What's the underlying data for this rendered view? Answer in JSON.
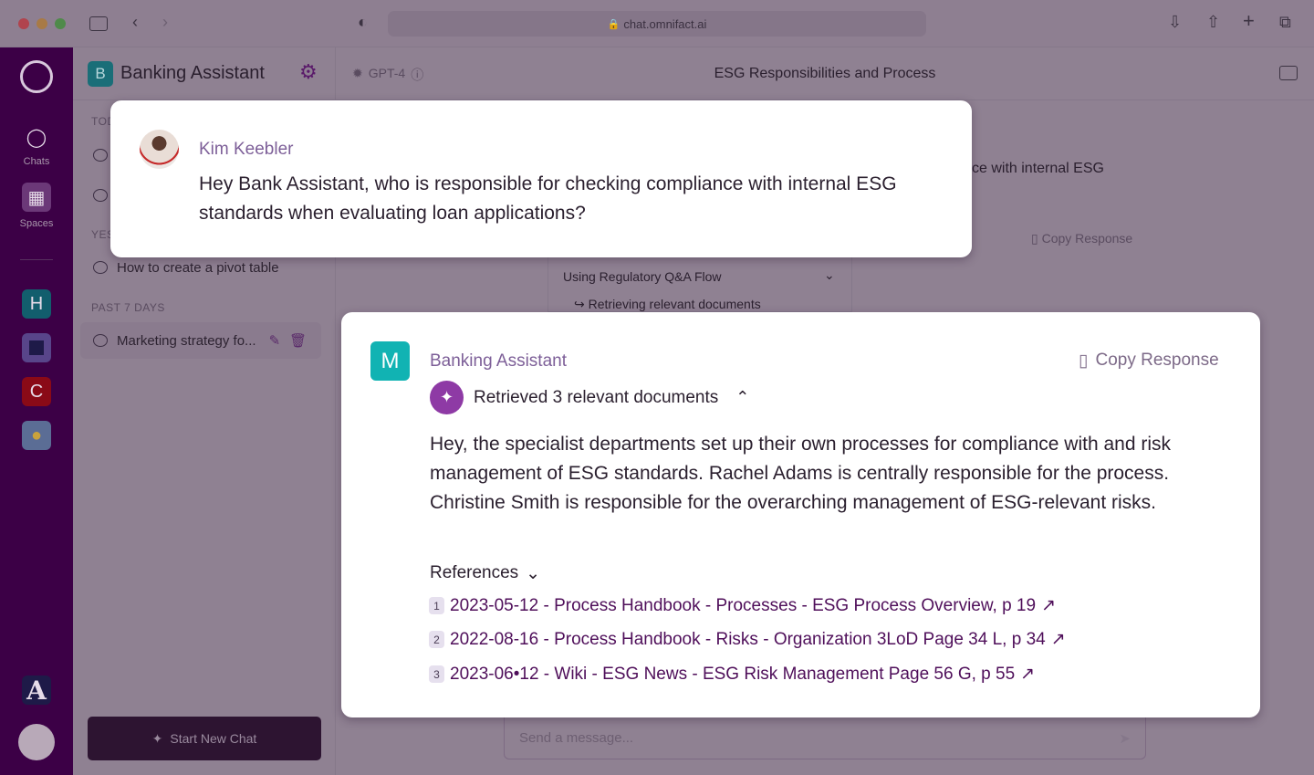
{
  "browser": {
    "url": "chat.omnifact.ai"
  },
  "rail": {
    "chats_label": "Chats",
    "spaces_label": "Spaces",
    "spaces": [
      {
        "letter": "H",
        "color": "#125e6d"
      },
      {
        "letter": "",
        "color": "#58458a"
      },
      {
        "letter": "C",
        "color": "#8a0a17"
      },
      {
        "letter": "",
        "color": "#5b6d95"
      }
    ],
    "bottom_letter": "A"
  },
  "chatlist": {
    "assistant_letter": "B",
    "assistant_name": "Banking Assistant",
    "sections": {
      "today": "TODAY",
      "yesterday": "YESTERDAY",
      "past7": "PAST 7 DAYS"
    },
    "items": {
      "yesterday_0": "How to create a pivot table",
      "past7_0": "Marketing strategy fo..."
    },
    "new_chat": "Start New Chat"
  },
  "header": {
    "model": "GPT-4",
    "title": "ESG Responsibilities and Process"
  },
  "background": {
    "partial_text": "ce with internal ESG",
    "copy": "Copy Response",
    "flow": "Using Regulatory Q&A Flow",
    "retrieving": "Retrieving relevant documents",
    "input_placeholder": "Send a message..."
  },
  "user_message": {
    "name": "Kim Keebler",
    "text": "Hey Bank Assistant, who is responsible for checking compliance with internal ESG standards when evaluating loan applications?"
  },
  "assistant_message": {
    "avatar_letter": "M",
    "avatar_color": "#11b3b3",
    "name": "Banking Assistant",
    "copy": "Copy Response",
    "retrieved": "Retrieved 3 relevant documents",
    "text": "Hey, the specialist departments set up their own processes for compliance with and risk management of ESG standards. Rachel Adams is centrally responsible for the process. Christine Smith is responsible for the overarching management of ESG-relevant risks.",
    "references_label": "References",
    "references": [
      {
        "n": "1",
        "text": "2023-05-12 - Process Handbook - Processes - ESG Process Overview, p 19"
      },
      {
        "n": "2",
        "text": "2022-08-16 - Process Handbook - Risks - Organization 3LoD Page 34 L, p 34"
      },
      {
        "n": "3",
        "text": "2023-06•12 - Wiki - ESG News - ESG Risk Management Page 56 G, p 55"
      }
    ]
  },
  "colors": {
    "rail": "#3c0046",
    "accent": "#8e3aa5",
    "link": "#4f0f5a"
  }
}
